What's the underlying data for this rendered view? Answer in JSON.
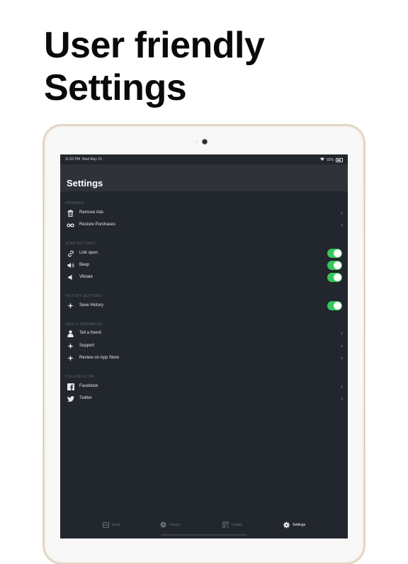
{
  "headline": {
    "line1": "User friendly",
    "line2": "Settings"
  },
  "status": {
    "time": "11:52 PM",
    "date": "Wed May 15",
    "wifi": "⌔",
    "battery": "92%"
  },
  "nav": {
    "title": "Settings"
  },
  "sections": {
    "upgrade": {
      "header": "UPGRADE",
      "rows": [
        {
          "label": "Remove Ads",
          "icon": "trash-icon",
          "accessory": "chevron"
        },
        {
          "label": "Restore Purchases",
          "icon": "infinity-icon",
          "accessory": "chevron"
        }
      ]
    },
    "scan": {
      "header": "SCAN SETTINGS",
      "rows": [
        {
          "label": "Link open",
          "icon": "link-icon",
          "accessory": "toggle",
          "on": true
        },
        {
          "label": "Beep",
          "icon": "speaker-loud-icon",
          "accessory": "toggle",
          "on": true
        },
        {
          "label": "Vibrate",
          "icon": "speaker-icon",
          "accessory": "toggle",
          "on": true
        }
      ]
    },
    "history": {
      "header": "HISTORY SETTINGS",
      "rows": [
        {
          "label": "Save History",
          "icon": "sparkle-icon",
          "accessory": "toggle",
          "on": true
        }
      ]
    },
    "help": {
      "header": "HELP & FEEDBACKS",
      "rows": [
        {
          "label": "Tell a friend",
          "icon": "person-icon",
          "accessory": "chevron"
        },
        {
          "label": "Support",
          "icon": "sparkle-icon",
          "accessory": "chevron"
        },
        {
          "label": "Review on App Store",
          "icon": "sparkle-icon",
          "accessory": "chevron"
        }
      ]
    },
    "follow": {
      "header": "FOLLOW US ON",
      "rows": [
        {
          "label": "Facebook",
          "icon": "facebook-icon",
          "accessory": "chevron"
        },
        {
          "label": "Twitter",
          "icon": "twitter-icon",
          "accessory": "chevron"
        }
      ]
    }
  },
  "tabs": [
    {
      "label": "Scan",
      "icon": "scan-icon",
      "active": false
    },
    {
      "label": "History",
      "icon": "clock-icon",
      "active": false
    },
    {
      "label": "Create",
      "icon": "qr-icon",
      "active": false
    },
    {
      "label": "Settings",
      "icon": "gear-icon",
      "active": true
    }
  ],
  "colors": {
    "screen_bg": "#22262d",
    "navbar_bg": "#2f3339",
    "toggle_on": "#34c759",
    "text_primary": "#e6e8eb",
    "section_header": "#5f6670"
  }
}
